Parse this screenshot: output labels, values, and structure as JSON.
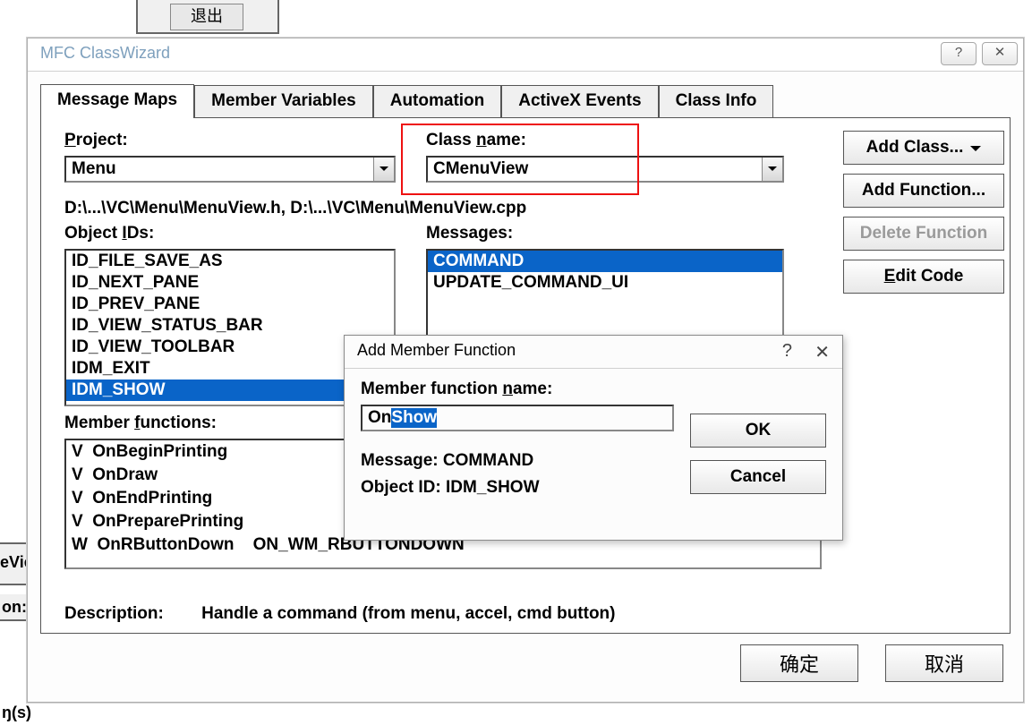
{
  "background": {
    "exit_label": "退出",
    "frag_left1": "eVie",
    "frag_left2": "on:",
    "frag_bottom": "ŋ(s)"
  },
  "dialog": {
    "title": "MFC ClassWizard",
    "help_glyph": "?",
    "close_glyph": "✕",
    "tabs": [
      "Message Maps",
      "Member Variables",
      "Automation",
      "ActiveX Events",
      "Class Info"
    ],
    "project_label": "Project:",
    "project_value": "Menu",
    "classname_label": "Class name:",
    "classname_value": "CMenuView",
    "file_path": "D:\\...\\VC\\Menu\\MenuView.h, D:\\...\\VC\\Menu\\MenuView.cpp",
    "objectids_label": "Object IDs:",
    "object_ids": [
      "ID_FILE_SAVE_AS",
      "ID_NEXT_PANE",
      "ID_PREV_PANE",
      "ID_VIEW_STATUS_BAR",
      "ID_VIEW_TOOLBAR",
      "IDM_EXIT",
      "IDM_SHOW"
    ],
    "object_ids_selected": "IDM_SHOW",
    "messages_label": "Messages:",
    "messages_list": [
      "COMMAND",
      "UPDATE_COMMAND_UI"
    ],
    "messages_selected": "COMMAND",
    "side_buttons": {
      "add_class": "Add Class...",
      "add_function": "Add Function...",
      "delete_function": "Delete Function",
      "edit_code": "Edit Code"
    },
    "memberfuncs_label": "Member functions:",
    "memberfuncs": [
      {
        "type": "V",
        "name": "OnBeginPrinting",
        "map": ""
      },
      {
        "type": "V",
        "name": "OnDraw",
        "map": ""
      },
      {
        "type": "V",
        "name": "OnEndPrinting",
        "map": ""
      },
      {
        "type": "V",
        "name": "OnPreparePrinting",
        "map": ""
      },
      {
        "type": "W",
        "name": "OnRButtonDown",
        "map": "ON_WM_RBUTTONDOWN"
      }
    ],
    "description_label": "Description:",
    "description_value": "Handle a command (from menu, accel, cmd button)",
    "ok_label": "确定",
    "cancel_label": "取消"
  },
  "modal": {
    "title": "Add Member Function",
    "help_glyph": "?",
    "close_glyph": "✕",
    "name_label": "Member function name:",
    "input_prefix": "On",
    "input_selected": "Show",
    "msg_label": "Message: COMMAND",
    "obj_label": "Object ID: IDM_SHOW",
    "ok_label": "OK",
    "cancel_label": "Cancel"
  }
}
